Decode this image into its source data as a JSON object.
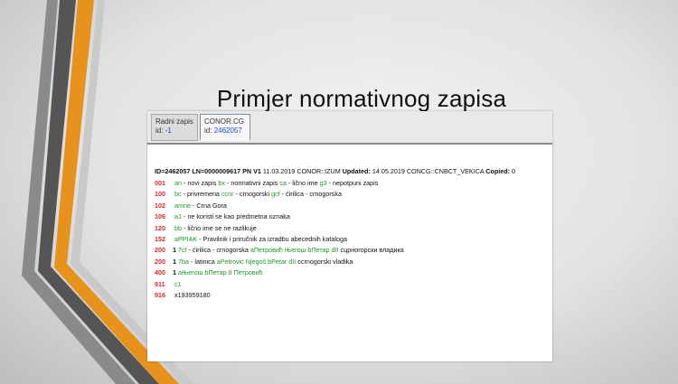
{
  "title": "Primjer normativnog zapisa",
  "tabs": [
    {
      "label": "Radni zapis",
      "id_prefix": "id:",
      "id_value": "-1"
    },
    {
      "label": "CONOR.CG",
      "id_prefix": "id:",
      "id_value": "2462057"
    }
  ],
  "record_header": {
    "id": "ID=2462057",
    "ln": "LN=0000009617",
    "pn": "PN V1",
    "date": "11.03.2019",
    "source": "CONOR::IZUM",
    "updated_label": "Updated:",
    "updated_value": "14.05.2019 CONCG::CNBCT_VEKICA",
    "copied_label": "Copied:",
    "copied_value": "0"
  },
  "rows": [
    {
      "tag": "001",
      "ind": "",
      "c1": "an",
      "t1": " - novi zapis ",
      "c2": "bx",
      "t2": " - normativni zapis ",
      "c3": "ca",
      "t3": " - lično ime ",
      "c4": "g3",
      "t4": " - nepotpuni zapis"
    },
    {
      "tag": "100",
      "ind": "",
      "c1": "bc",
      "t1": " - privremena ",
      "c2": "ccnr",
      "t2": " - crnogorski ",
      "c3": "gcf",
      "t3": " - ćirilica - crnogorska",
      "c4": "",
      "t4": ""
    },
    {
      "tag": "102",
      "ind": "",
      "c1": "amne",
      "t1": " - Crna Gora",
      "c2": "",
      "t2": "",
      "c3": "",
      "t3": "",
      "c4": "",
      "t4": ""
    },
    {
      "tag": "106",
      "ind": "",
      "c1": "a1",
      "t1": " - ne koristi se kao predmetna oznaka",
      "c2": "",
      "t2": "",
      "c3": "",
      "t3": "",
      "c4": "",
      "t4": ""
    },
    {
      "tag": "120",
      "ind": "",
      "c1": "bb",
      "t1": " - lično ime se ne razlikuje",
      "c2": "",
      "t2": "",
      "c3": "",
      "t3": "",
      "c4": "",
      "t4": ""
    },
    {
      "tag": "152",
      "ind": "",
      "c1": "aPPIAK",
      "t1": " - Pravilnik i priručnik za izradbu abecednih kataloga",
      "c2": "",
      "t2": "",
      "c3": "",
      "t3": "",
      "c4": "",
      "t4": ""
    },
    {
      "tag": "200",
      "ind": "1",
      "c1": "7cf",
      "t1": " - ćirilica - crnogorska ",
      "c2": "aПетровић Његош ",
      "t2": "",
      "c3": "bПетар ",
      "t3": "",
      "c4": "dII ",
      "t4": "сцрногорски владика"
    },
    {
      "tag": "200",
      "ind": "1",
      "c1": "7ba",
      "t1": " - latinica ",
      "c2": "aPetrović Njegoš ",
      "t2": "",
      "c3": "bPetar ",
      "t3": "",
      "c4": "dII ",
      "t4": "ccrnogorski vladika"
    },
    {
      "tag": "400",
      "ind": "1",
      "c1": "aЊегош ",
      "t1": "",
      "c2": "bПетар II Петровић",
      "t2": "",
      "c3": "",
      "t3": "",
      "c4": "",
      "t4": ""
    },
    {
      "tag": "911",
      "ind": "",
      "c1": "c1",
      "t1": "",
      "c2": "",
      "t2": "",
      "c3": "",
      "t3": "",
      "c4": "",
      "t4": ""
    },
    {
      "tag": "916",
      "ind": "",
      "c1": "",
      "t1": "x193959180",
      "c2": "",
      "t2": "",
      "c3": "",
      "t3": "",
      "c4": "",
      "t4": ""
    }
  ]
}
